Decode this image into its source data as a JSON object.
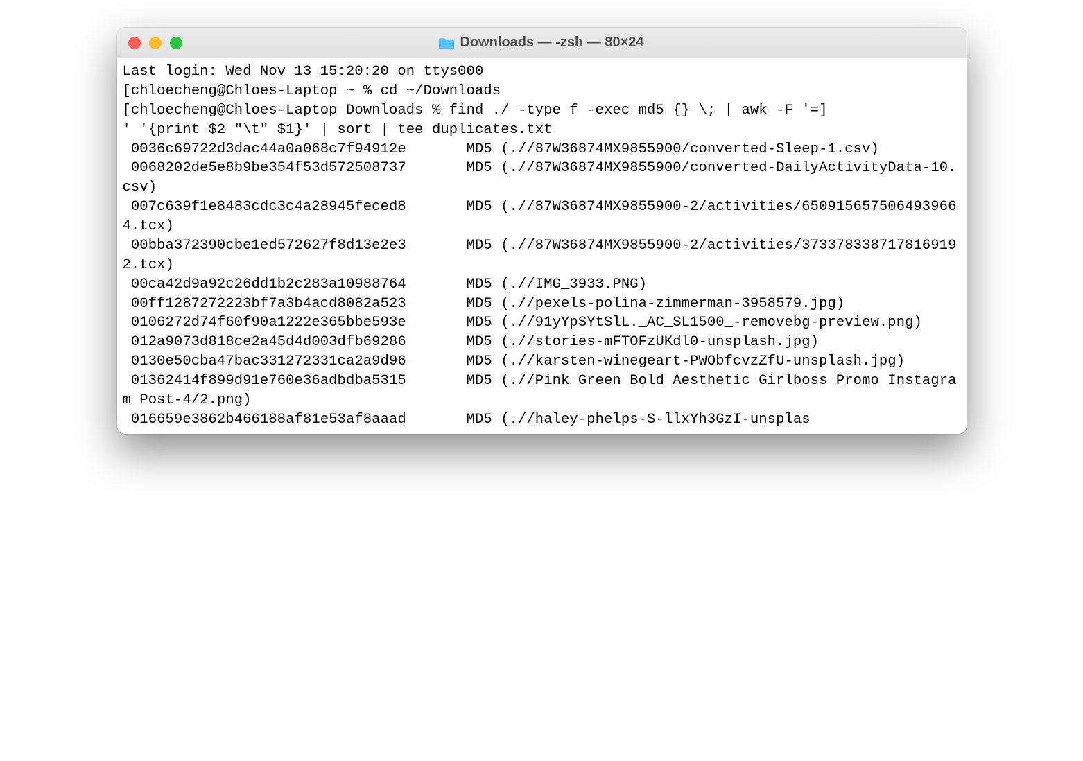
{
  "window": {
    "title": "Downloads — -zsh — 80×24"
  },
  "terminal": {
    "last_login": "Last login: Wed Nov 13 15:20:20 on ttys000",
    "prompt1_open": "[",
    "prompt1": "chloecheng@Chloes-Laptop ~ % ",
    "cmd1": "cd ~/Downloads",
    "prompt1_close": "]",
    "prompt2_open": "[",
    "prompt2": "chloecheng@Chloes-Laptop Downloads % ",
    "cmd2_a": "find ./ -type f -exec md5 {} \\; | awk -F '=",
    "prompt2_close": "]",
    "cmd2_b": "' '{print $2 \"\\t\" $1}' | sort | tee duplicates.txt",
    "out1": " 0036c69722d3dac44a0a068c7f94912e \tMD5 (.//87W36874MX9855900/converted-Sleep-1.csv)",
    "out2": " 0068202de5e8b9be354f53d572508737 \tMD5 (.//87W36874MX9855900/converted-DailyActivityData-10.csv)",
    "out3": " 007c639f1e8483cdc3c4a28945feced8 \tMD5 (.//87W36874MX9855900-2/activities/6509156575064939664.tcx)",
    "out4": " 00bba372390cbe1ed572627f8d13e2e3 \tMD5 (.//87W36874MX9855900-2/activities/3733783387178169192.tcx)",
    "out5": " 00ca42d9a92c26dd1b2c283a10988764 \tMD5 (.//IMG_3933.PNG)",
    "out6": " 00ff1287272223bf7a3b4acd8082a523 \tMD5 (.//pexels-polina-zimmerman-3958579.jpg)",
    "out7": " 0106272d74f60f90a1222e365bbe593e \tMD5 (.//91yYpSYtSlL._AC_SL1500_-removebg-preview.png)",
    "out8": " 012a9073d818ce2a45d4d003dfb69286 \tMD5 (.//stories-mFTOFzUKdl0-unsplash.jpg)",
    "out9": " 0130e50cba47bac331272331ca2a9d96 \tMD5 (.//karsten-winegeart-PWObfcvzZfU-unsplash.jpg)",
    "out10": " 01362414f899d91e760e36adbdba5315 \tMD5 (.//Pink Green Bold Aesthetic Girlboss Promo Instagram Post-4/2.png)",
    "out11": " 016659e3862b466188af81e53af8aaad \tMD5 (.//haley-phelps-S-llxYh3GzI-unsplas"
  }
}
